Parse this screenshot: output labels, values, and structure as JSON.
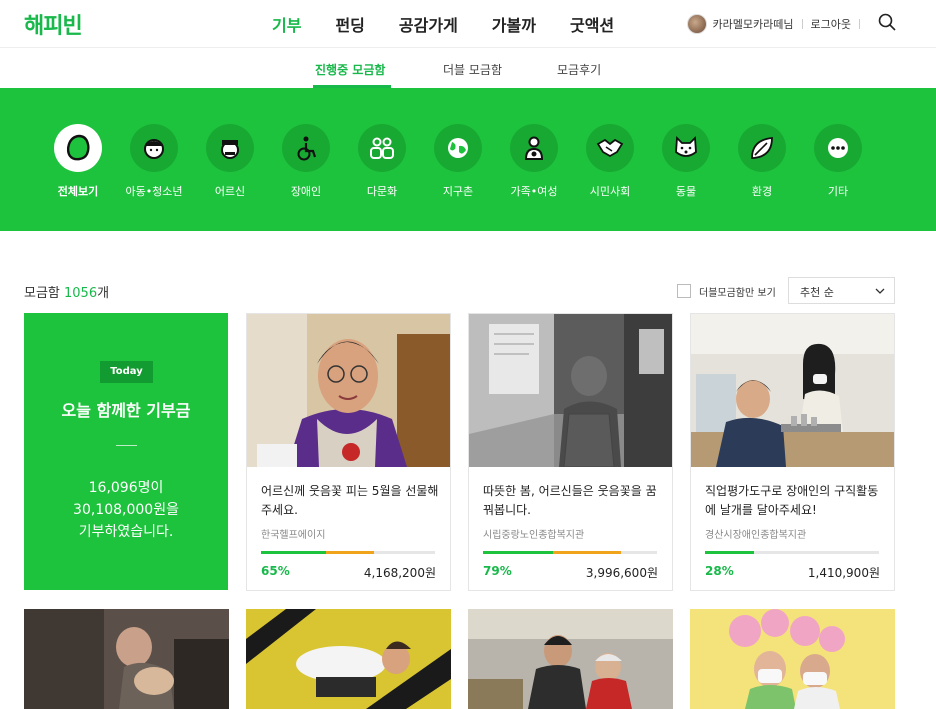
{
  "brand": {
    "logo": "해피빈",
    "accent": "#1ec33d"
  },
  "mainnav": [
    "기부",
    "펀딩",
    "공감가게",
    "가볼까",
    "굿액션"
  ],
  "user": {
    "name": "카라멜모카라떼님",
    "logout": "로그아웃"
  },
  "subnav": [
    "진행중 모금함",
    "더블 모금함",
    "모금후기"
  ],
  "categories": [
    "전체보기",
    "아동•청소년",
    "어르신",
    "장애인",
    "다문화",
    "지구촌",
    "가족•여성",
    "시민사회",
    "동물",
    "환경",
    "기타"
  ],
  "list": {
    "label": "모금함 ",
    "count": "1056",
    "unit": "개",
    "double_only": "더블모금함만 보기",
    "sort": "추천 순"
  },
  "today": {
    "badge": "Today",
    "title": "오늘 함께한 기부금",
    "donors": "16,096명이",
    "amount": "30,108,000원을",
    "suffix": "기부하였습니다."
  },
  "cards": [
    {
      "title": "어르신께 웃음꽃 피는 5월을 선물해주세요.",
      "org": "한국헬프에이지",
      "percent": "65%",
      "amount": "4,168,200원",
      "progress": 0.65
    },
    {
      "title": "따뜻한 봄, 어르신들은 웃음꽃을 꿈꿔봅니다.",
      "org": "시립중랑노인종합복지관",
      "percent": "79%",
      "amount": "3,996,600원",
      "progress": 0.79
    },
    {
      "title": "직업평가도구로 장애인의 구직활동에 날개를 달아주세요!",
      "org": "경산시장애인종합복지관",
      "percent": "28%",
      "amount": "1,410,900원",
      "progress": 0.28
    }
  ]
}
